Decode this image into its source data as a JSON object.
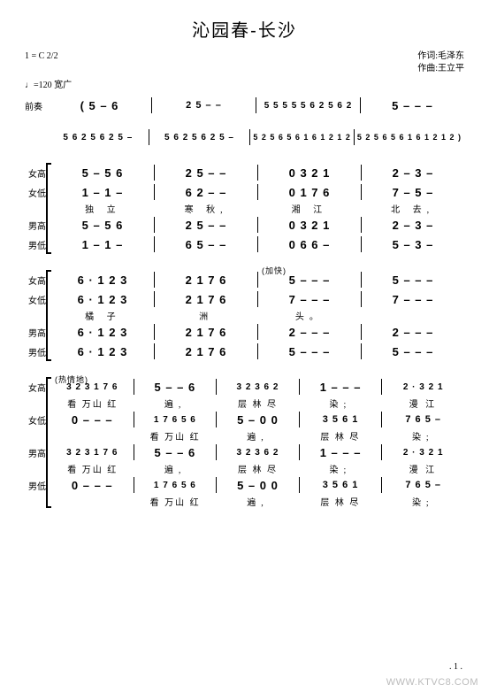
{
  "title": "沁园春-长沙",
  "key_sig": "1 = C 2/2",
  "tempo": "♩=120  宽广",
  "credit_lyric": "作词:毛泽东",
  "credit_music": "作曲:王立平",
  "parts": {
    "intro": "前奏",
    "sop": "女高",
    "alto": "女低",
    "ten": "男高",
    "bass": "男低"
  },
  "intro_line1": {
    "b1": "( 5 – 6",
    "b2": "2 5 – –",
    "b3": "5  5 5 5 5 6 2 5 6 2",
    "b4": "5 – – –"
  },
  "intro_line2": {
    "b1": "5 6 2 5 6 2  5  –",
    "b2": "5 6 2 5 6 2  5  –",
    "b3": "5 2 5 6 5 6 1 6 1 2 1 2",
    "b4": "5 2 5 6 5 6 1 6 1 2 1 2 )"
  },
  "sys3": {
    "sop": {
      "b1": "5 – 5 6",
      "b2": "2  5 – –",
      "b3": "0  3 2 1",
      "b4": "2 – 3 –"
    },
    "alto": {
      "b1": "1 – 1 –",
      "b2": "6  2 – –",
      "b3": "0  1 7 6",
      "b4": "7 – 5 –"
    },
    "ten": {
      "b1": "5 – 5 6",
      "b2": "2  5 – –",
      "b3": "0  3 2 1",
      "b4": "2 – 3 –"
    },
    "bass": {
      "b1": "1 – 1 –",
      "b2": "6  5 – –",
      "b3": "0  6 6 –",
      "b4": "5 – 3 –"
    },
    "lyr": {
      "b1": "独   立",
      "b2": "寒  秋,",
      "b3": "湘 江",
      "b4": "北   去,"
    }
  },
  "sys4": {
    "marker": "(加快)",
    "sop": {
      "b1": "6 · 1  2  3",
      "b2": "2 1 7 6",
      "b3": "5 – – –",
      "b4": "5 – – –"
    },
    "alto": {
      "b1": "6 · 1  2  3",
      "b2": "2 1 7 6",
      "b3": "7 – – –",
      "b4": "7 – – –"
    },
    "ten": {
      "b1": "6 · 1  2  3",
      "b2": "2 1 7 6",
      "b3": "2 – – –",
      "b4": "2 – – –"
    },
    "bass": {
      "b1": "6 · 1  2  3",
      "b2": "2 1 7 6",
      "b3": "5 – – –",
      "b4": "5 – – –"
    },
    "lyr": {
      "b1": "橘    子",
      "b2": "洲",
      "b3": "头。",
      "b4": ""
    }
  },
  "sys5": {
    "marker": "(热情地)",
    "sop": {
      "b1": "3  2 3 1 7 6",
      "b2": "5 – – 6",
      "b3": "3  2 3  6  2",
      "b4": "1 – – –",
      "b5": "2 · 3  2  1"
    },
    "alto": {
      "b1": "0 – – –",
      "b2": "1  7 6  5  6",
      "b3": "5 – 0 0",
      "b4": "3  5  6  1",
      "b5": "7  6  5 –"
    },
    "ten": {
      "b1": "3  2 3 1 7 6",
      "b2": "5 – – 6",
      "b3": "3  2 3  6  2",
      "b4": "1 – – –",
      "b5": "2 · 3  2  1"
    },
    "bass": {
      "b1": "0 – – –",
      "b2": "1  7 6  5  6",
      "b3": "5 – 0 0",
      "b4": "3  5  6  1",
      "b5": "7  6  5 –"
    },
    "lyr_top": {
      "b1": "看  万山 红",
      "b2": "遍,",
      "b3": "层 林 尽",
      "b4": "染;",
      "b5": "漫   江"
    },
    "lyr_alto": {
      "b1": "",
      "b2": "看 万山  红",
      "b3": "遍,",
      "b4": "层 林 尽",
      "b5": "染;"
    },
    "lyr_bass": {
      "b1": "",
      "b2": "看 万山  红",
      "b3": "遍,",
      "b4": "层 林 尽",
      "b5": "染;"
    }
  },
  "watermark": "WWW.KTVC8.COM",
  "page_num": ". 1 ."
}
